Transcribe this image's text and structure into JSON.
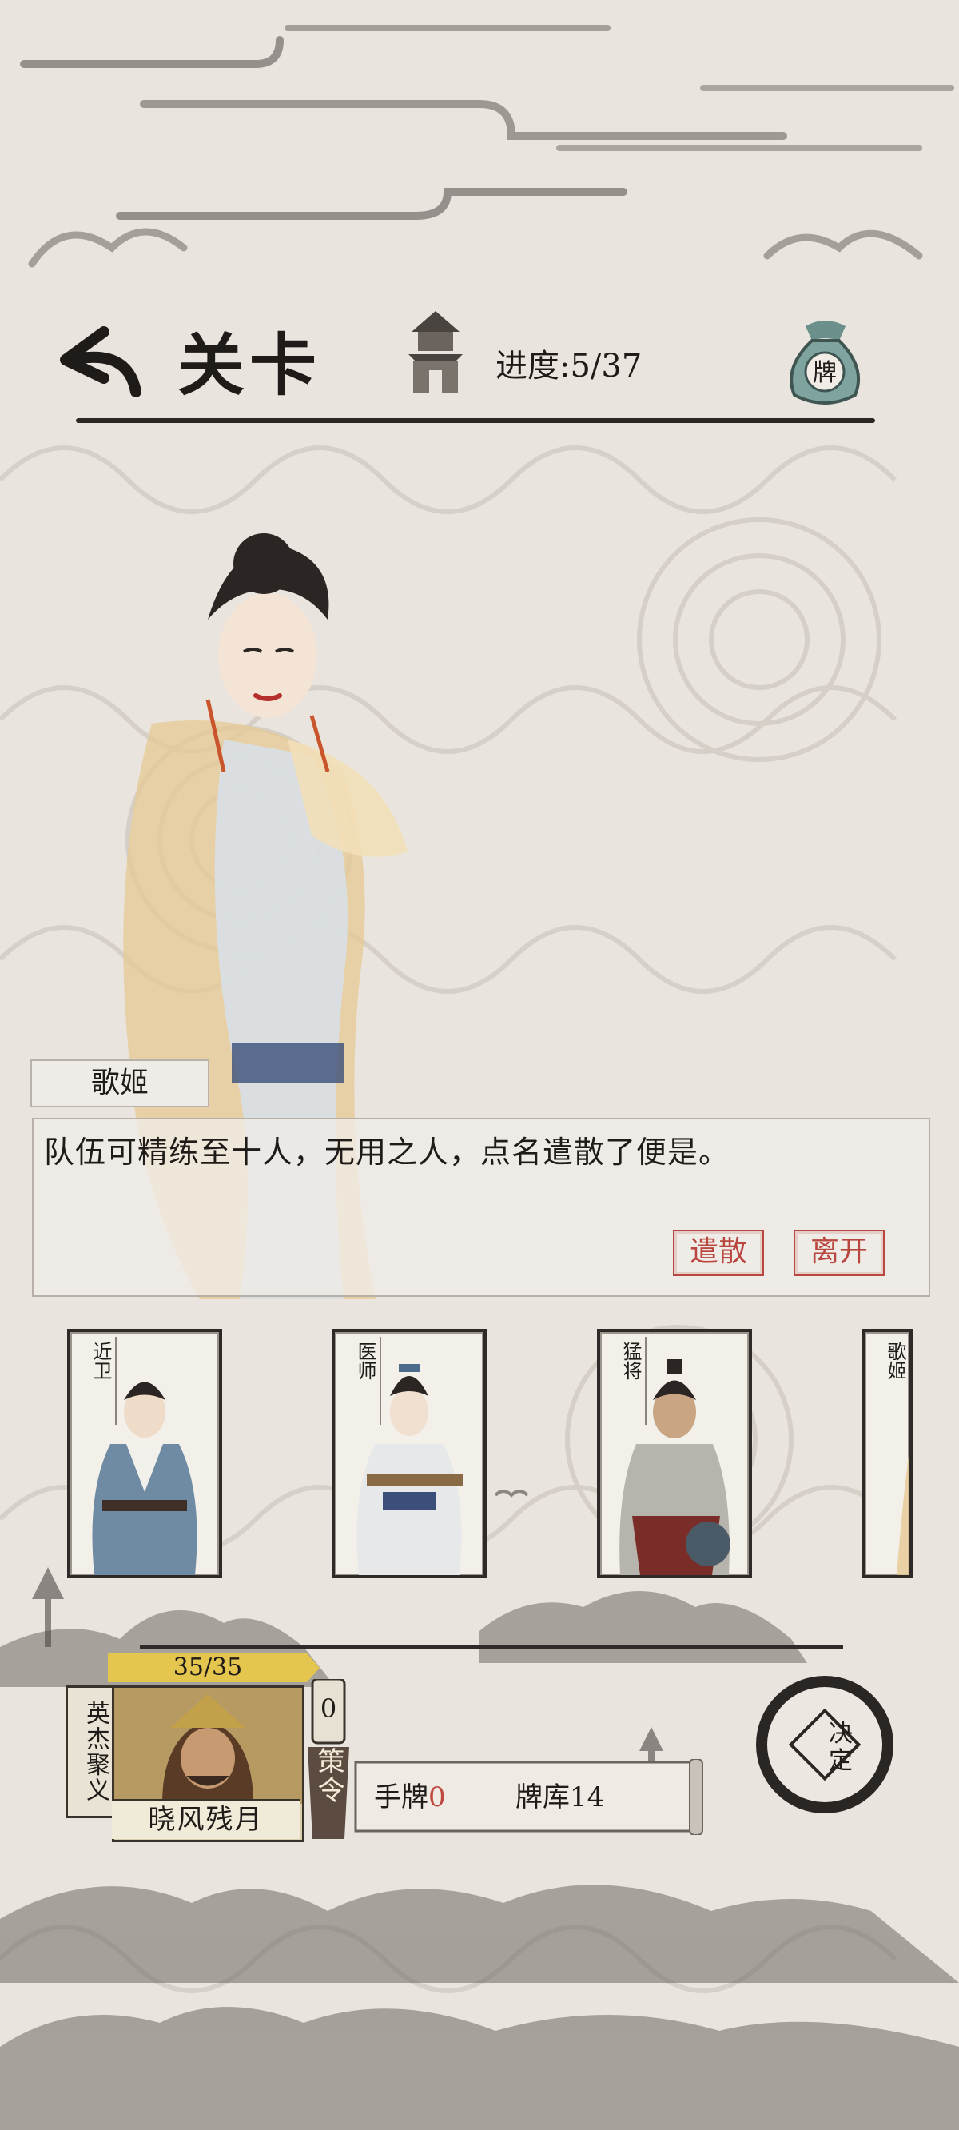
{
  "header": {
    "title": "关卡",
    "progress_label": "进度:5/37",
    "pouch_label": "牌"
  },
  "dialog": {
    "speaker": "歌姬",
    "text": "队伍可精练至十人，无用之人，点名遣散了便是。",
    "dismiss_label": "遣散",
    "leave_label": "离开"
  },
  "cards": [
    {
      "role": "近卫"
    },
    {
      "role": "医师"
    },
    {
      "role": "猛将"
    },
    {
      "role": "歌姬"
    }
  ],
  "hero": {
    "hp": "35/35",
    "hp_fraction": 1.0,
    "banner": "英杰聚义",
    "name": "晓风残月"
  },
  "tactics": {
    "count": "0",
    "label": "策令"
  },
  "resources": {
    "hand_label": "手牌",
    "hand_count": "0",
    "deck_label": "牌库",
    "deck_count": "14"
  },
  "decide": {
    "char1": "决",
    "char2": "定"
  },
  "colors": {
    "background": "#e9e4de",
    "ink": "#1e1b18",
    "seal_red": "#b9473f",
    "hp_gold": "#e4c64f"
  }
}
